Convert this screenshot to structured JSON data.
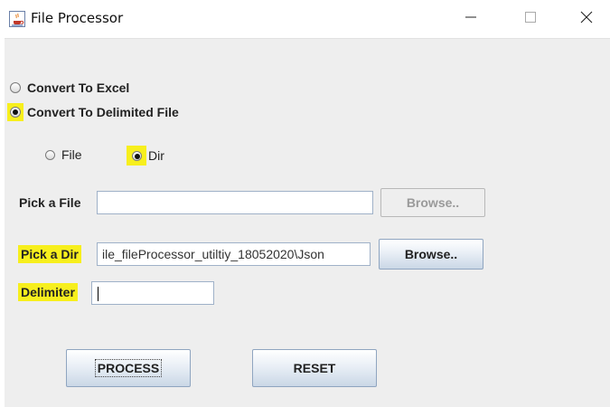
{
  "window": {
    "title": "File Processor",
    "controls": {
      "minimize": "—",
      "maximize": "☐",
      "close": "✕"
    }
  },
  "output_mode": {
    "options": [
      {
        "label": "Convert To Excel",
        "selected": false
      },
      {
        "label": "Convert To Delimited File",
        "selected": true
      }
    ]
  },
  "source_type": {
    "options": [
      {
        "label": "File",
        "selected": false
      },
      {
        "label": "Dir",
        "selected": true
      }
    ]
  },
  "file_picker": {
    "label": "Pick a File",
    "value": "",
    "browse_label": "Browse.."
  },
  "dir_picker": {
    "label": "Pick a Dir",
    "value": "ile_fileProcessor_utiltiy_18052020\\Json",
    "browse_label": "Browse.."
  },
  "delimiter": {
    "label": "Delimiter",
    "value": ""
  },
  "actions": {
    "process_label": "PROCESS",
    "reset_label": "RESET"
  },
  "colors": {
    "highlight": "#f7ef1d",
    "window_bg": "#eeeeee",
    "button_border": "#8fa5c0"
  }
}
